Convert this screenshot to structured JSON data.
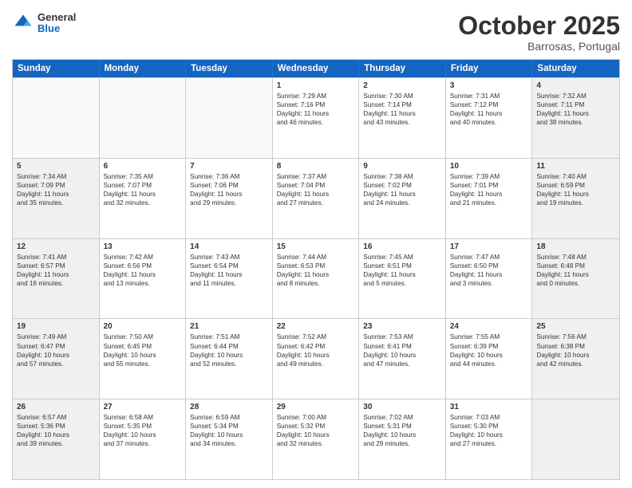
{
  "header": {
    "logo_general": "General",
    "logo_blue": "Blue",
    "month_title": "October 2025",
    "location": "Barrosas, Portugal"
  },
  "days_of_week": [
    "Sunday",
    "Monday",
    "Tuesday",
    "Wednesday",
    "Thursday",
    "Friday",
    "Saturday"
  ],
  "weeks": [
    [
      {
        "day": "",
        "text": "",
        "empty": true
      },
      {
        "day": "",
        "text": "",
        "empty": true
      },
      {
        "day": "",
        "text": "",
        "empty": true
      },
      {
        "day": "1",
        "text": "Sunrise: 7:29 AM\nSunset: 7:16 PM\nDaylight: 11 hours\nand 46 minutes.",
        "empty": false
      },
      {
        "day": "2",
        "text": "Sunrise: 7:30 AM\nSunset: 7:14 PM\nDaylight: 11 hours\nand 43 minutes.",
        "empty": false
      },
      {
        "day": "3",
        "text": "Sunrise: 7:31 AM\nSunset: 7:12 PM\nDaylight: 11 hours\nand 40 minutes.",
        "empty": false
      },
      {
        "day": "4",
        "text": "Sunrise: 7:32 AM\nSunset: 7:11 PM\nDaylight: 11 hours\nand 38 minutes.",
        "empty": false,
        "shaded": true
      }
    ],
    [
      {
        "day": "5",
        "text": "Sunrise: 7:34 AM\nSunset: 7:09 PM\nDaylight: 11 hours\nand 35 minutes.",
        "empty": false,
        "shaded": true
      },
      {
        "day": "6",
        "text": "Sunrise: 7:35 AM\nSunset: 7:07 PM\nDaylight: 11 hours\nand 32 minutes.",
        "empty": false
      },
      {
        "day": "7",
        "text": "Sunrise: 7:36 AM\nSunset: 7:06 PM\nDaylight: 11 hours\nand 29 minutes.",
        "empty": false
      },
      {
        "day": "8",
        "text": "Sunrise: 7:37 AM\nSunset: 7:04 PM\nDaylight: 11 hours\nand 27 minutes.",
        "empty": false
      },
      {
        "day": "9",
        "text": "Sunrise: 7:38 AM\nSunset: 7:02 PM\nDaylight: 11 hours\nand 24 minutes.",
        "empty": false
      },
      {
        "day": "10",
        "text": "Sunrise: 7:39 AM\nSunset: 7:01 PM\nDaylight: 11 hours\nand 21 minutes.",
        "empty": false
      },
      {
        "day": "11",
        "text": "Sunrise: 7:40 AM\nSunset: 6:59 PM\nDaylight: 11 hours\nand 19 minutes.",
        "empty": false,
        "shaded": true
      }
    ],
    [
      {
        "day": "12",
        "text": "Sunrise: 7:41 AM\nSunset: 6:57 PM\nDaylight: 11 hours\nand 16 minutes.",
        "empty": false,
        "shaded": true
      },
      {
        "day": "13",
        "text": "Sunrise: 7:42 AM\nSunset: 6:56 PM\nDaylight: 11 hours\nand 13 minutes.",
        "empty": false
      },
      {
        "day": "14",
        "text": "Sunrise: 7:43 AM\nSunset: 6:54 PM\nDaylight: 11 hours\nand 11 minutes.",
        "empty": false
      },
      {
        "day": "15",
        "text": "Sunrise: 7:44 AM\nSunset: 6:53 PM\nDaylight: 11 hours\nand 8 minutes.",
        "empty": false
      },
      {
        "day": "16",
        "text": "Sunrise: 7:45 AM\nSunset: 6:51 PM\nDaylight: 11 hours\nand 5 minutes.",
        "empty": false
      },
      {
        "day": "17",
        "text": "Sunrise: 7:47 AM\nSunset: 6:50 PM\nDaylight: 11 hours\nand 3 minutes.",
        "empty": false
      },
      {
        "day": "18",
        "text": "Sunrise: 7:48 AM\nSunset: 6:48 PM\nDaylight: 11 hours\nand 0 minutes.",
        "empty": false,
        "shaded": true
      }
    ],
    [
      {
        "day": "19",
        "text": "Sunrise: 7:49 AM\nSunset: 6:47 PM\nDaylight: 10 hours\nand 57 minutes.",
        "empty": false,
        "shaded": true
      },
      {
        "day": "20",
        "text": "Sunrise: 7:50 AM\nSunset: 6:45 PM\nDaylight: 10 hours\nand 55 minutes.",
        "empty": false
      },
      {
        "day": "21",
        "text": "Sunrise: 7:51 AM\nSunset: 6:44 PM\nDaylight: 10 hours\nand 52 minutes.",
        "empty": false
      },
      {
        "day": "22",
        "text": "Sunrise: 7:52 AM\nSunset: 6:42 PM\nDaylight: 10 hours\nand 49 minutes.",
        "empty": false
      },
      {
        "day": "23",
        "text": "Sunrise: 7:53 AM\nSunset: 6:41 PM\nDaylight: 10 hours\nand 47 minutes.",
        "empty": false
      },
      {
        "day": "24",
        "text": "Sunrise: 7:55 AM\nSunset: 6:39 PM\nDaylight: 10 hours\nand 44 minutes.",
        "empty": false
      },
      {
        "day": "25",
        "text": "Sunrise: 7:56 AM\nSunset: 6:38 PM\nDaylight: 10 hours\nand 42 minutes.",
        "empty": false,
        "shaded": true
      }
    ],
    [
      {
        "day": "26",
        "text": "Sunrise: 6:57 AM\nSunset: 5:36 PM\nDaylight: 10 hours\nand 39 minutes.",
        "empty": false,
        "shaded": true
      },
      {
        "day": "27",
        "text": "Sunrise: 6:58 AM\nSunset: 5:35 PM\nDaylight: 10 hours\nand 37 minutes.",
        "empty": false
      },
      {
        "day": "28",
        "text": "Sunrise: 6:59 AM\nSunset: 5:34 PM\nDaylight: 10 hours\nand 34 minutes.",
        "empty": false
      },
      {
        "day": "29",
        "text": "Sunrise: 7:00 AM\nSunset: 5:32 PM\nDaylight: 10 hours\nand 32 minutes.",
        "empty": false
      },
      {
        "day": "30",
        "text": "Sunrise: 7:02 AM\nSunset: 5:31 PM\nDaylight: 10 hours\nand 29 minutes.",
        "empty": false
      },
      {
        "day": "31",
        "text": "Sunrise: 7:03 AM\nSunset: 5:30 PM\nDaylight: 10 hours\nand 27 minutes.",
        "empty": false
      },
      {
        "day": "",
        "text": "",
        "empty": true,
        "shaded": true
      }
    ]
  ]
}
